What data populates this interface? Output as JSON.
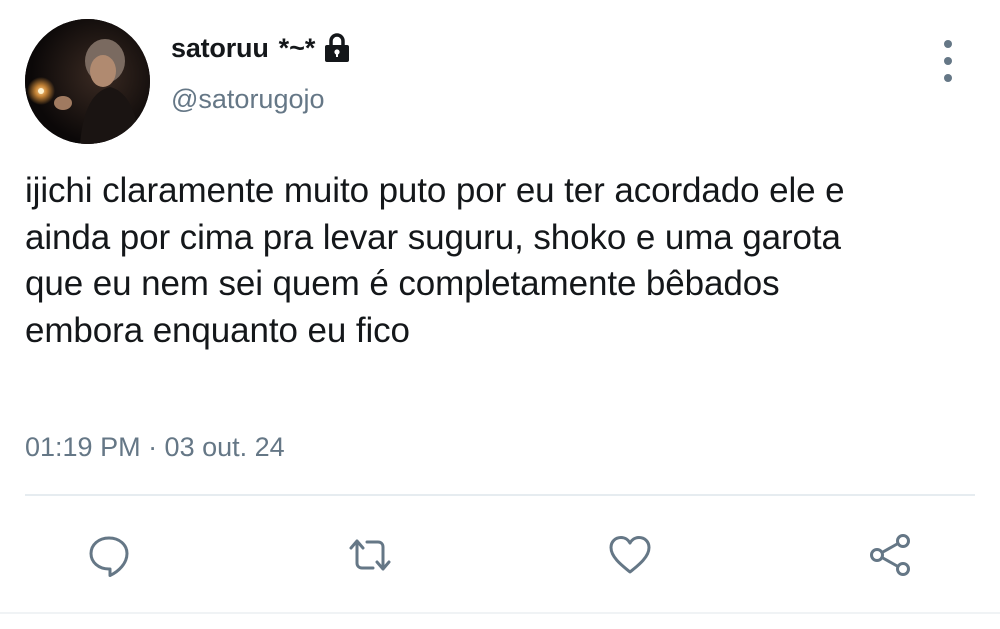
{
  "user": {
    "display_name": "satoruu",
    "name_decoration": "*~*",
    "handle": "@satorugojo",
    "protected_icon": "lock-icon"
  },
  "tweet": {
    "text": "ijichi claramente muito puto por eu ter acordado ele e\nainda por cima pra levar suguru, shoko e uma garota\nque eu nem sei quem é completamente bêbados\nembora enquanto eu fico",
    "timestamp": "01:19 PM · 03 out. 24"
  },
  "actions": [
    {
      "name": "reply",
      "icon": "comment-icon"
    },
    {
      "name": "retweet",
      "icon": "retweet-icon"
    },
    {
      "name": "like",
      "icon": "heart-icon"
    },
    {
      "name": "share",
      "icon": "share-icon"
    }
  ],
  "colors": {
    "text_primary": "#14171a",
    "text_secondary": "#657786",
    "divider": "#e6ecf0",
    "background": "#ffffff"
  }
}
